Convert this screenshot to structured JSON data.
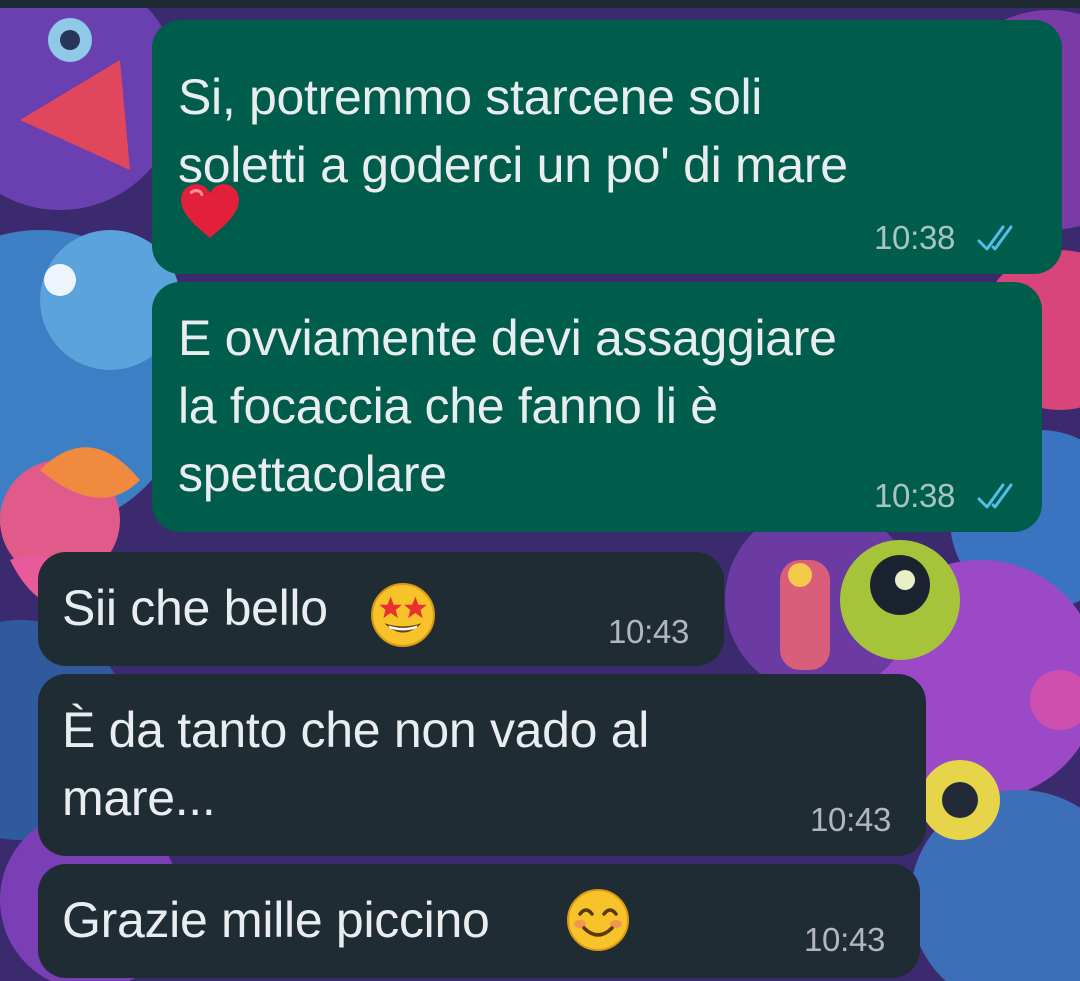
{
  "colors": {
    "outgoing_bubble": "#005c4b",
    "incoming_bubble": "#202c33",
    "text": "#e9edef",
    "read_ticks": "#53bdeb"
  },
  "messages": [
    {
      "direction": "outgoing",
      "lines": [
        "Si, potremmo starcene soli",
        "soletti a goderci un po' di mare"
      ],
      "emoji": "red-heart",
      "time": "10:38",
      "status": "read"
    },
    {
      "direction": "outgoing",
      "lines": [
        "E ovviamente devi assaggiare",
        "la focaccia che fanno li è",
        "spettacolare"
      ],
      "time": "10:38",
      "status": "read"
    },
    {
      "direction": "incoming",
      "lines": [
        "Sii che bello"
      ],
      "emoji": "star-struck",
      "time": "10:43"
    },
    {
      "direction": "incoming",
      "lines": [
        "È da tanto che non vado al",
        "mare..."
      ],
      "time": "10:43"
    },
    {
      "direction": "incoming",
      "lines": [
        "Grazie mille piccino"
      ],
      "emoji": "smiling-face",
      "time": "10:43"
    }
  ]
}
